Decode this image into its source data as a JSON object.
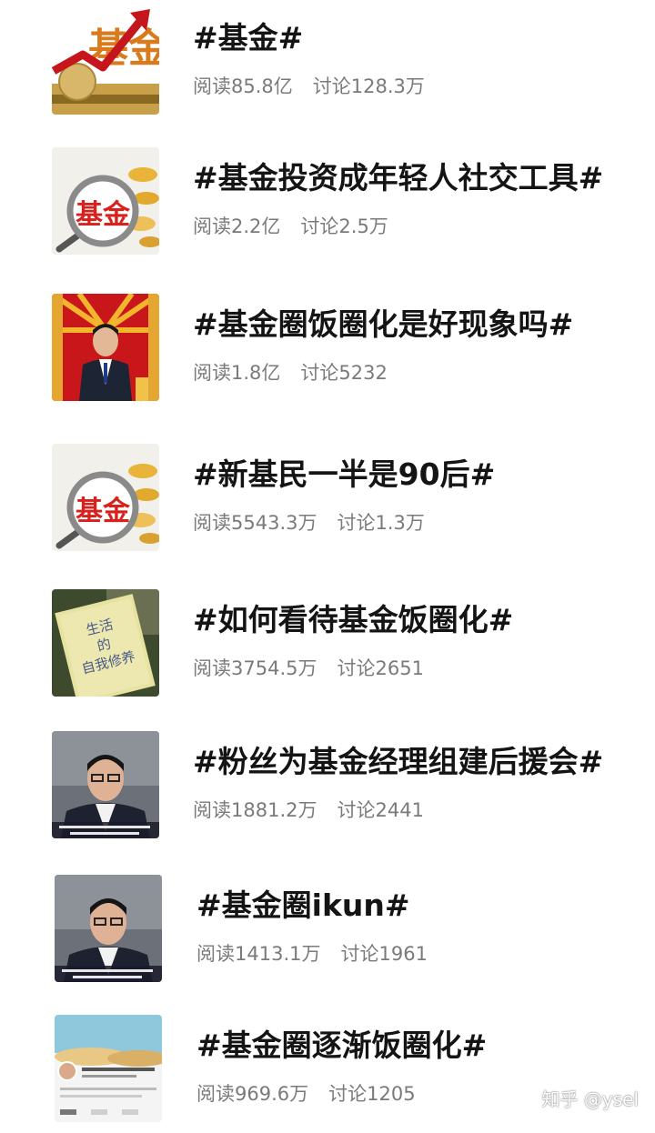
{
  "topics": [
    {
      "title": "#基金#",
      "read": "阅读85.8亿",
      "discuss": "讨论128.3万",
      "thumb": "fund-arrow-coins"
    },
    {
      "title": "#基金投资成年轻人社交工具#",
      "read": "阅读2.2亿",
      "discuss": "讨论2.5万",
      "thumb": "fund-magnifier"
    },
    {
      "title": "#基金圈饭圈化是好现象吗#",
      "read": "阅读1.8亿",
      "discuss": "讨论5232",
      "thumb": "man-red-backdrop"
    },
    {
      "title": "#新基民一半是90后#",
      "read": "阅读5543.3万",
      "discuss": "讨论1.3万",
      "thumb": "fund-magnifier"
    },
    {
      "title": "#如何看待基金饭圈化#",
      "read": "阅读3754.5万",
      "discuss": "讨论2651",
      "thumb": "book-cover"
    },
    {
      "title": "#粉丝为基金经理组建后援会#",
      "read": "阅读1881.2万",
      "discuss": "讨论2441",
      "thumb": "man-portrait"
    },
    {
      "title": "#基金圈ikun#",
      "read": "阅读1413.1万",
      "discuss": "讨论1961",
      "thumb": "man-portrait"
    },
    {
      "title": "#基金圈逐渐饭圈化#",
      "read": "阅读969.6万",
      "discuss": "讨论1205",
      "thumb": "sky-post"
    }
  ],
  "thumb_text": {
    "fund": "基金",
    "book": [
      "生活",
      "的",
      "自我修养"
    ]
  },
  "watermark": "知乎 @ysel",
  "colors": {
    "title": "#141414",
    "stats": "#7a7a7a",
    "fund_red": "#d8201c",
    "gold": "#e7b43a"
  }
}
